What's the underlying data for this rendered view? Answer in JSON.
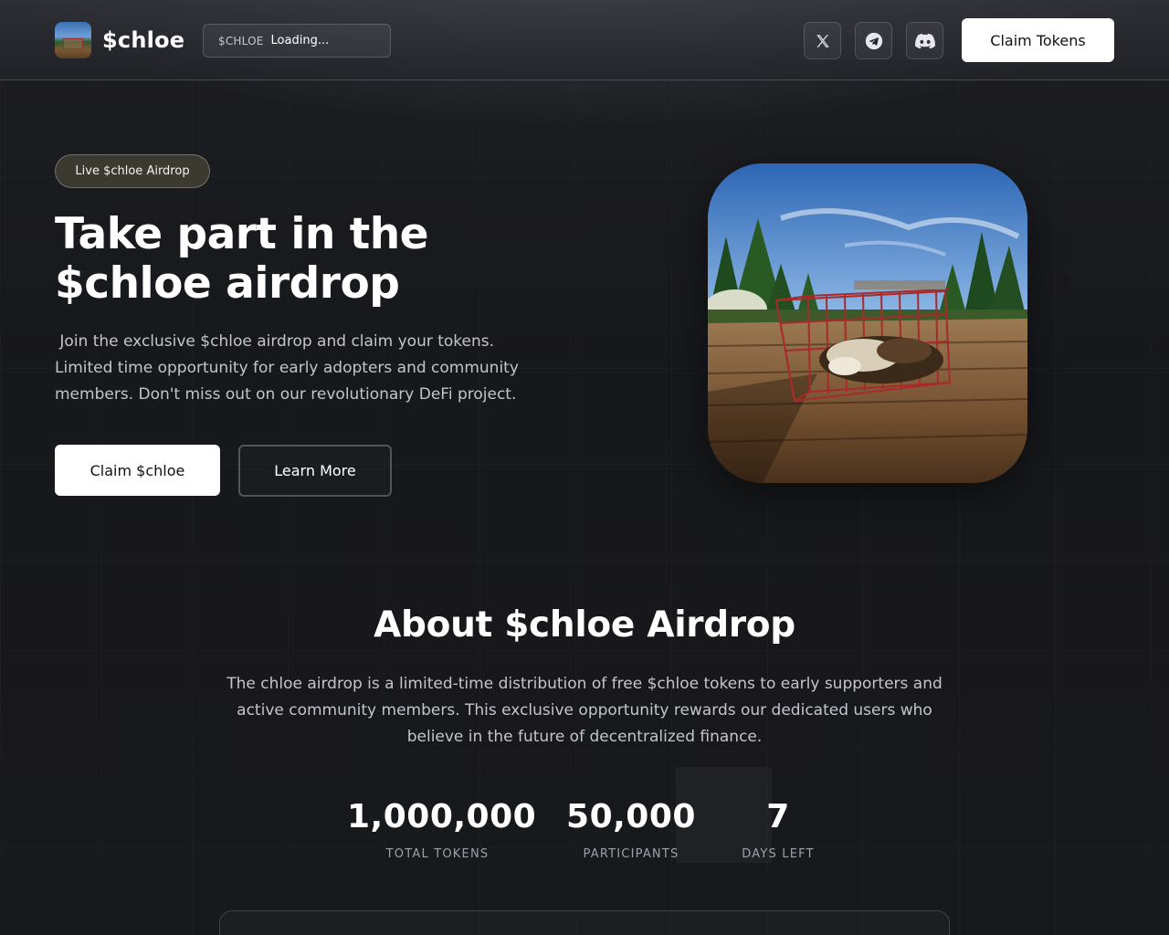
{
  "header": {
    "logo_text": "$chloe",
    "ticker_symbol": "$CHLOE",
    "ticker_price": "Loading...",
    "social": [
      "x-icon",
      "telegram-icon",
      "discord-icon"
    ],
    "cta_label": "Claim Tokens"
  },
  "hero": {
    "badge": "Live $chloe Airdrop",
    "title": "Take part in the $chloe airdrop",
    "description": " Join the exclusive $chloe airdrop and claim your tokens. Limited time opportunity for early adopters and community members. Don't miss out on our revolutionary DeFi project.",
    "primary_button": "Claim $chloe",
    "secondary_button": "Learn More"
  },
  "about": {
    "title": "About $chloe Airdrop",
    "description": "The chloe airdrop is a limited-time distribution of free $chloe tokens to early supporters and active community members. This exclusive opportunity rewards our dedicated users who believe in the future of decentralized finance.",
    "stats": [
      {
        "value": "1,000,000",
        "label": "TOTAL TOKENS"
      },
      {
        "value": "50,000",
        "label": "PARTICIPANTS"
      },
      {
        "value": "7",
        "label": "DAYS LEFT"
      }
    ]
  },
  "colors": {
    "background": "#18191c",
    "button_primary_bg": "#ffffff",
    "badge_bg": "#5a543e",
    "muted_text": "#c4c5cc"
  }
}
